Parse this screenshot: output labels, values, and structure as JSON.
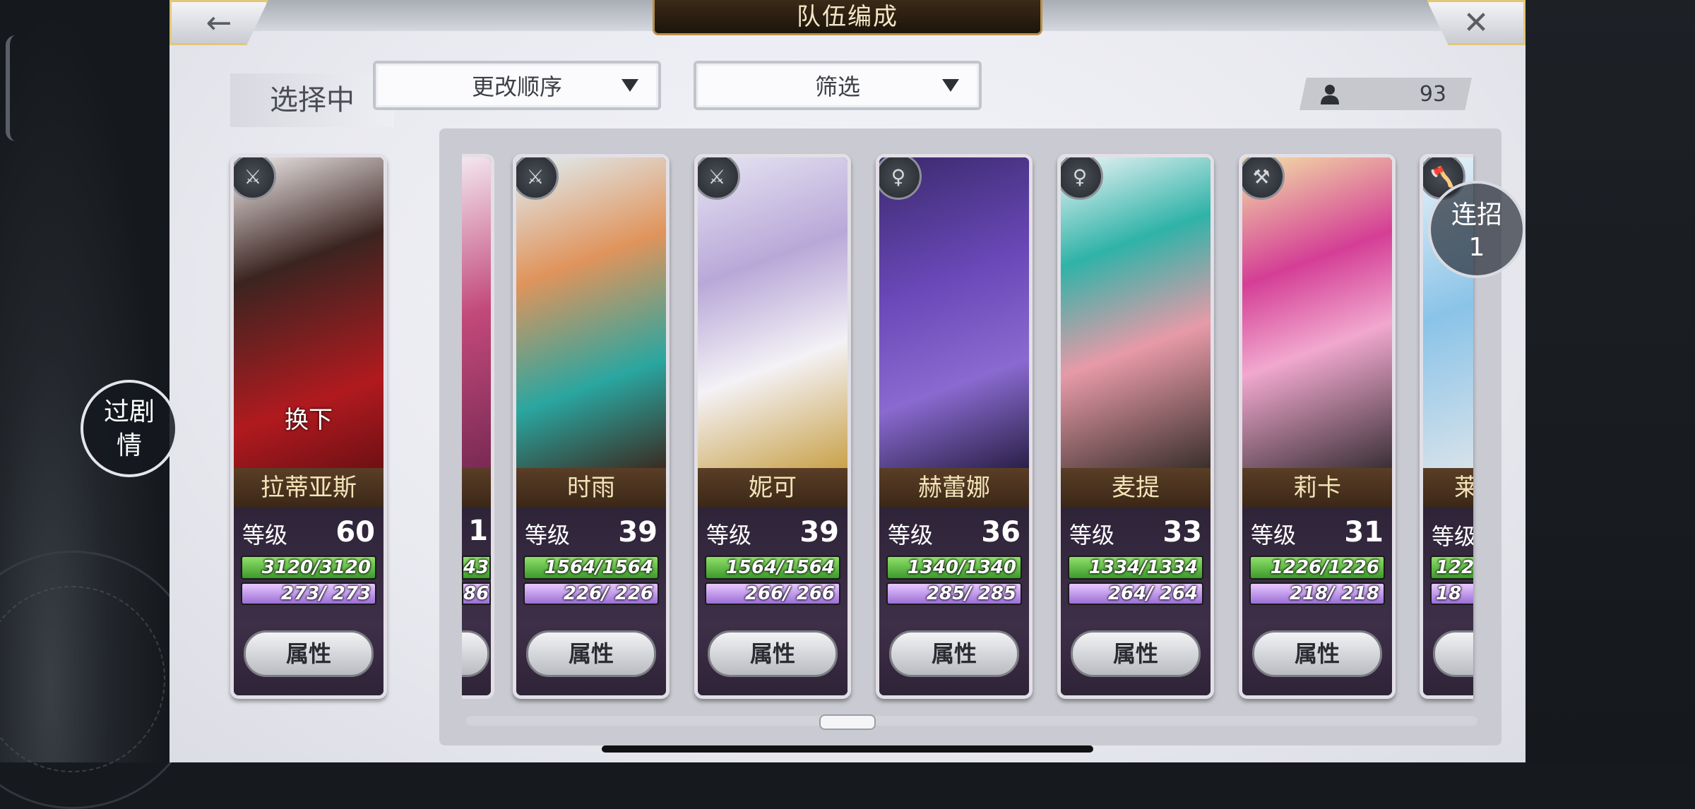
{
  "header": {
    "title": "队伍编成",
    "back_icon": "←",
    "close_icon": "✕"
  },
  "selecting_label": "选择中",
  "dropdowns": {
    "order_label": "更改顺序",
    "filter_label": "筛选"
  },
  "roster_count": "93",
  "combo": {
    "label": "连招",
    "value": "1"
  },
  "cutscene_label_line1": "过剧",
  "cutscene_label_line2": "情",
  "level_label": "等级",
  "attr_label": "属性",
  "swap_label": "换下",
  "selected_card": {
    "name": "拉蒂亚斯",
    "level": "60",
    "hp": "3120/3120",
    "mp": "273/ 273",
    "weapon": "sword"
  },
  "partial_card": {
    "level": "1",
    "hp": "43",
    "mp": "86"
  },
  "cards": [
    {
      "name": "时雨",
      "level": "39",
      "hp": "1564/1564",
      "mp": "226/ 226",
      "weapon": "sword"
    },
    {
      "name": "妮可",
      "level": "39",
      "hp": "1564/1564",
      "mp": "266/ 266",
      "weapon": "sword"
    },
    {
      "name": "赫蕾娜",
      "level": "36",
      "hp": "1340/1340",
      "mp": "285/ 285",
      "weapon": "staff"
    },
    {
      "name": "麦提",
      "level": "33",
      "hp": "1334/1334",
      "mp": "264/ 264",
      "weapon": "staff"
    },
    {
      "name": "莉卡",
      "level": "31",
      "hp": "1226/1226",
      "mp": "218/ 218",
      "weapon": "hammer"
    }
  ],
  "cut_card": {
    "name": "莱",
    "level_label": "等级",
    "hp": "122",
    "mp": "18",
    "weapon": "axe"
  },
  "colors": {
    "accent_gold": "#b89048",
    "hp_green": "#3d9a2c",
    "mp_purple": "#9b6fd6"
  }
}
